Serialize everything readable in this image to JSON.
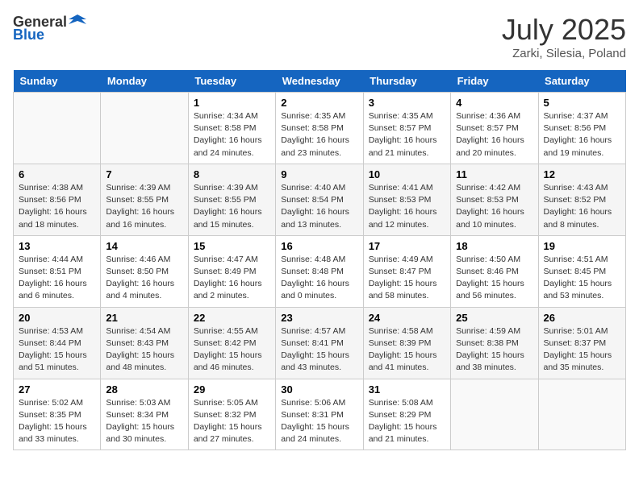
{
  "header": {
    "logo_general": "General",
    "logo_blue": "Blue",
    "title": "July 2025",
    "location": "Zarki, Silesia, Poland"
  },
  "days_of_week": [
    "Sunday",
    "Monday",
    "Tuesday",
    "Wednesday",
    "Thursday",
    "Friday",
    "Saturday"
  ],
  "weeks": [
    [
      {
        "day": "",
        "info": ""
      },
      {
        "day": "",
        "info": ""
      },
      {
        "day": "1",
        "info": "Sunrise: 4:34 AM\nSunset: 8:58 PM\nDaylight: 16 hours and 24 minutes."
      },
      {
        "day": "2",
        "info": "Sunrise: 4:35 AM\nSunset: 8:58 PM\nDaylight: 16 hours and 23 minutes."
      },
      {
        "day": "3",
        "info": "Sunrise: 4:35 AM\nSunset: 8:57 PM\nDaylight: 16 hours and 21 minutes."
      },
      {
        "day": "4",
        "info": "Sunrise: 4:36 AM\nSunset: 8:57 PM\nDaylight: 16 hours and 20 minutes."
      },
      {
        "day": "5",
        "info": "Sunrise: 4:37 AM\nSunset: 8:56 PM\nDaylight: 16 hours and 19 minutes."
      }
    ],
    [
      {
        "day": "6",
        "info": "Sunrise: 4:38 AM\nSunset: 8:56 PM\nDaylight: 16 hours and 18 minutes."
      },
      {
        "day": "7",
        "info": "Sunrise: 4:39 AM\nSunset: 8:55 PM\nDaylight: 16 hours and 16 minutes."
      },
      {
        "day": "8",
        "info": "Sunrise: 4:39 AM\nSunset: 8:55 PM\nDaylight: 16 hours and 15 minutes."
      },
      {
        "day": "9",
        "info": "Sunrise: 4:40 AM\nSunset: 8:54 PM\nDaylight: 16 hours and 13 minutes."
      },
      {
        "day": "10",
        "info": "Sunrise: 4:41 AM\nSunset: 8:53 PM\nDaylight: 16 hours and 12 minutes."
      },
      {
        "day": "11",
        "info": "Sunrise: 4:42 AM\nSunset: 8:53 PM\nDaylight: 16 hours and 10 minutes."
      },
      {
        "day": "12",
        "info": "Sunrise: 4:43 AM\nSunset: 8:52 PM\nDaylight: 16 hours and 8 minutes."
      }
    ],
    [
      {
        "day": "13",
        "info": "Sunrise: 4:44 AM\nSunset: 8:51 PM\nDaylight: 16 hours and 6 minutes."
      },
      {
        "day": "14",
        "info": "Sunrise: 4:46 AM\nSunset: 8:50 PM\nDaylight: 16 hours and 4 minutes."
      },
      {
        "day": "15",
        "info": "Sunrise: 4:47 AM\nSunset: 8:49 PM\nDaylight: 16 hours and 2 minutes."
      },
      {
        "day": "16",
        "info": "Sunrise: 4:48 AM\nSunset: 8:48 PM\nDaylight: 16 hours and 0 minutes."
      },
      {
        "day": "17",
        "info": "Sunrise: 4:49 AM\nSunset: 8:47 PM\nDaylight: 15 hours and 58 minutes."
      },
      {
        "day": "18",
        "info": "Sunrise: 4:50 AM\nSunset: 8:46 PM\nDaylight: 15 hours and 56 minutes."
      },
      {
        "day": "19",
        "info": "Sunrise: 4:51 AM\nSunset: 8:45 PM\nDaylight: 15 hours and 53 minutes."
      }
    ],
    [
      {
        "day": "20",
        "info": "Sunrise: 4:53 AM\nSunset: 8:44 PM\nDaylight: 15 hours and 51 minutes."
      },
      {
        "day": "21",
        "info": "Sunrise: 4:54 AM\nSunset: 8:43 PM\nDaylight: 15 hours and 48 minutes."
      },
      {
        "day": "22",
        "info": "Sunrise: 4:55 AM\nSunset: 8:42 PM\nDaylight: 15 hours and 46 minutes."
      },
      {
        "day": "23",
        "info": "Sunrise: 4:57 AM\nSunset: 8:41 PM\nDaylight: 15 hours and 43 minutes."
      },
      {
        "day": "24",
        "info": "Sunrise: 4:58 AM\nSunset: 8:39 PM\nDaylight: 15 hours and 41 minutes."
      },
      {
        "day": "25",
        "info": "Sunrise: 4:59 AM\nSunset: 8:38 PM\nDaylight: 15 hours and 38 minutes."
      },
      {
        "day": "26",
        "info": "Sunrise: 5:01 AM\nSunset: 8:37 PM\nDaylight: 15 hours and 35 minutes."
      }
    ],
    [
      {
        "day": "27",
        "info": "Sunrise: 5:02 AM\nSunset: 8:35 PM\nDaylight: 15 hours and 33 minutes."
      },
      {
        "day": "28",
        "info": "Sunrise: 5:03 AM\nSunset: 8:34 PM\nDaylight: 15 hours and 30 minutes."
      },
      {
        "day": "29",
        "info": "Sunrise: 5:05 AM\nSunset: 8:32 PM\nDaylight: 15 hours and 27 minutes."
      },
      {
        "day": "30",
        "info": "Sunrise: 5:06 AM\nSunset: 8:31 PM\nDaylight: 15 hours and 24 minutes."
      },
      {
        "day": "31",
        "info": "Sunrise: 5:08 AM\nSunset: 8:29 PM\nDaylight: 15 hours and 21 minutes."
      },
      {
        "day": "",
        "info": ""
      },
      {
        "day": "",
        "info": ""
      }
    ]
  ]
}
